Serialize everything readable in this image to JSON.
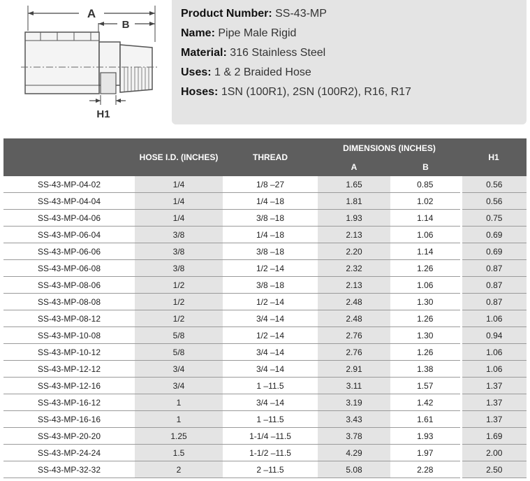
{
  "diagram": {
    "label_a": "A",
    "label_b": "B",
    "label_h1": "H1"
  },
  "product": {
    "number_label": "Product Number:",
    "number_value": "SS-43-MP",
    "name_label": "Name:",
    "name_value": "Pipe Male Rigid",
    "material_label": "Material:",
    "material_value": "316 Stainless Steel",
    "uses_label": "Uses:",
    "uses_value": "1 & 2 Braided Hose",
    "hoses_label": "Hoses:",
    "hoses_value": "1SN (100R1), 2SN (100R2), R16, R17"
  },
  "table": {
    "headers": {
      "hose_id": "HOSE I.D. (INCHES)",
      "thread": "THREAD",
      "dimensions": "DIMENSIONS (INCHES)",
      "a": "A",
      "b": "B",
      "h1": "H1"
    },
    "rows": [
      [
        "SS-43-MP-04-02",
        "1/4",
        "1/8 –27",
        "1.65",
        "0.85",
        "0.56"
      ],
      [
        "SS-43-MP-04-04",
        "1/4",
        "1/4 –18",
        "1.81",
        "1.02",
        "0.56"
      ],
      [
        "SS-43-MP-04-06",
        "1/4",
        "3/8 –18",
        "1.93",
        "1.14",
        "0.75"
      ],
      [
        "SS-43-MP-06-04",
        "3/8",
        "1/4 –18",
        "2.13",
        "1.06",
        "0.69"
      ],
      [
        "SS-43-MP-06-06",
        "3/8",
        "3/8 –18",
        "2.20",
        "1.14",
        "0.69"
      ],
      [
        "SS-43-MP-06-08",
        "3/8",
        "1/2 –14",
        "2.32",
        "1.26",
        "0.87"
      ],
      [
        "SS-43-MP-08-06",
        "1/2",
        "3/8 –18",
        "2.13",
        "1.06",
        "0.87"
      ],
      [
        "SS-43-MP-08-08",
        "1/2",
        "1/2 –14",
        "2.48",
        "1.30",
        "0.87"
      ],
      [
        "SS-43-MP-08-12",
        "1/2",
        "3/4 –14",
        "2.48",
        "1.26",
        "1.06"
      ],
      [
        "SS-43-MP-10-08",
        "5/8",
        "1/2 –14",
        "2.76",
        "1.30",
        "0.94"
      ],
      [
        "SS-43-MP-10-12",
        "5/8",
        "3/4 –14",
        "2.76",
        "1.26",
        "1.06"
      ],
      [
        "SS-43-MP-12-12",
        "3/4",
        "3/4 –14",
        "2.91",
        "1.38",
        "1.06"
      ],
      [
        "SS-43-MP-12-16",
        "3/4",
        "1 –11.5",
        "3.11",
        "1.57",
        "1.37"
      ],
      [
        "SS-43-MP-16-12",
        "1",
        "3/4 –14",
        "3.19",
        "1.42",
        "1.37"
      ],
      [
        "SS-43-MP-16-16",
        "1",
        "1 –11.5",
        "3.43",
        "1.61",
        "1.37"
      ],
      [
        "SS-43-MP-20-20",
        "1.25",
        "1-1/4 –11.5",
        "3.78",
        "1.93",
        "1.69"
      ],
      [
        "SS-43-MP-24-24",
        "1.5",
        "1-1/2 –11.5",
        "4.29",
        "1.97",
        "2.00"
      ],
      [
        "SS-43-MP-32-32",
        "2",
        "2 –11.5",
        "5.08",
        "2.28",
        "2.50"
      ]
    ]
  }
}
